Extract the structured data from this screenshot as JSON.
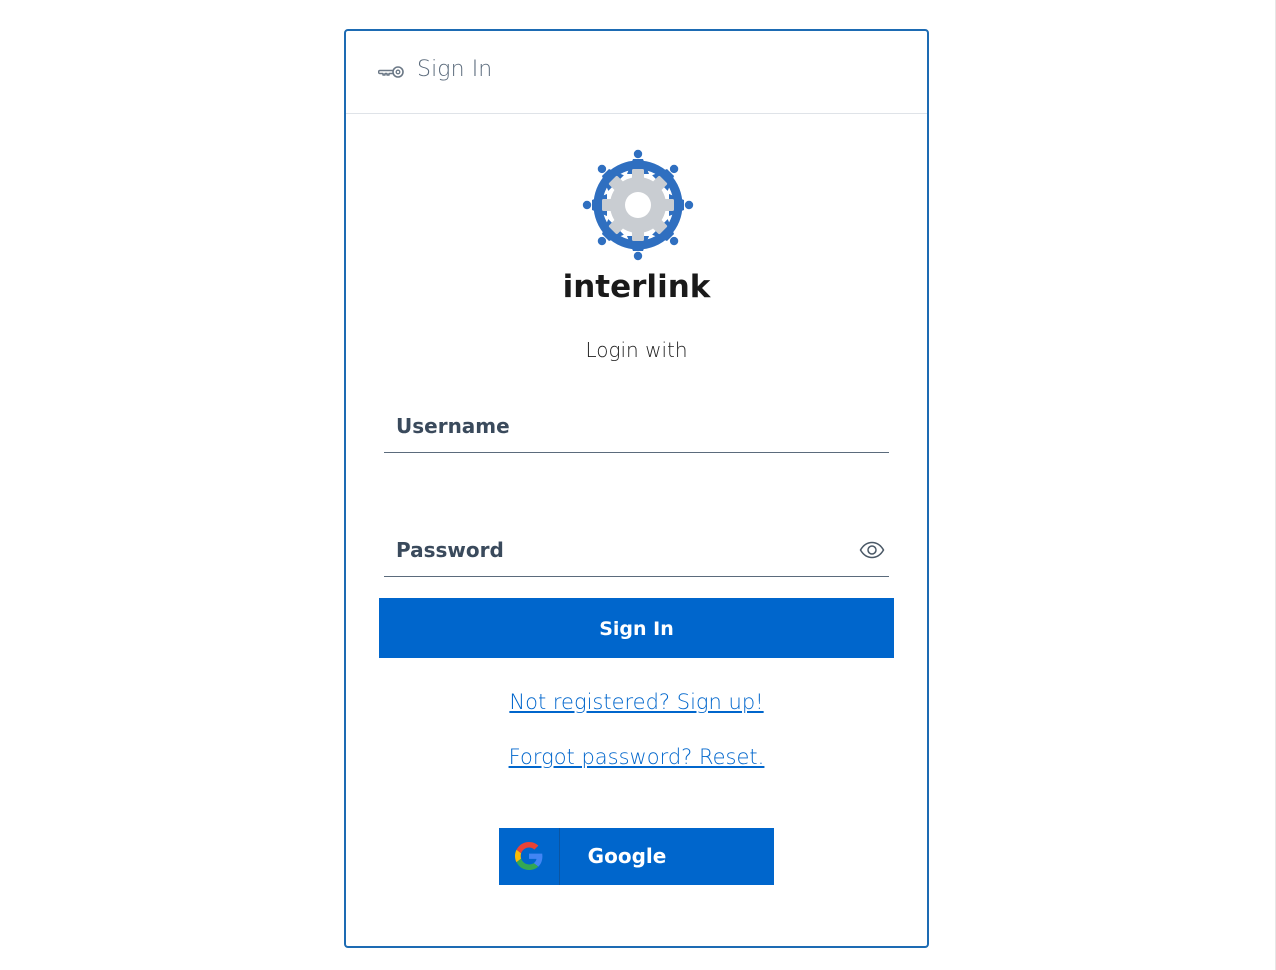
{
  "header": {
    "icon": "key-icon",
    "title": "Sign In"
  },
  "brand": {
    "logo": "interlink-gear-logo",
    "name": "interlink"
  },
  "form": {
    "login_with": "Login with",
    "username": {
      "placeholder": "Username",
      "value": ""
    },
    "password": {
      "placeholder": "Password",
      "value": "",
      "toggle_icon": "eye-icon"
    },
    "submit_label": "Sign In"
  },
  "links": {
    "register": "Not registered? Sign up!",
    "forgot": "Forgot password? Reset."
  },
  "social": {
    "google_label": "Google",
    "google_icon": "google-icon"
  },
  "colors": {
    "primary": "#0066cc",
    "card_border": "#1d6bb3",
    "logo_blue": "#2f6fc0",
    "logo_gray": "#c9cdd2"
  }
}
